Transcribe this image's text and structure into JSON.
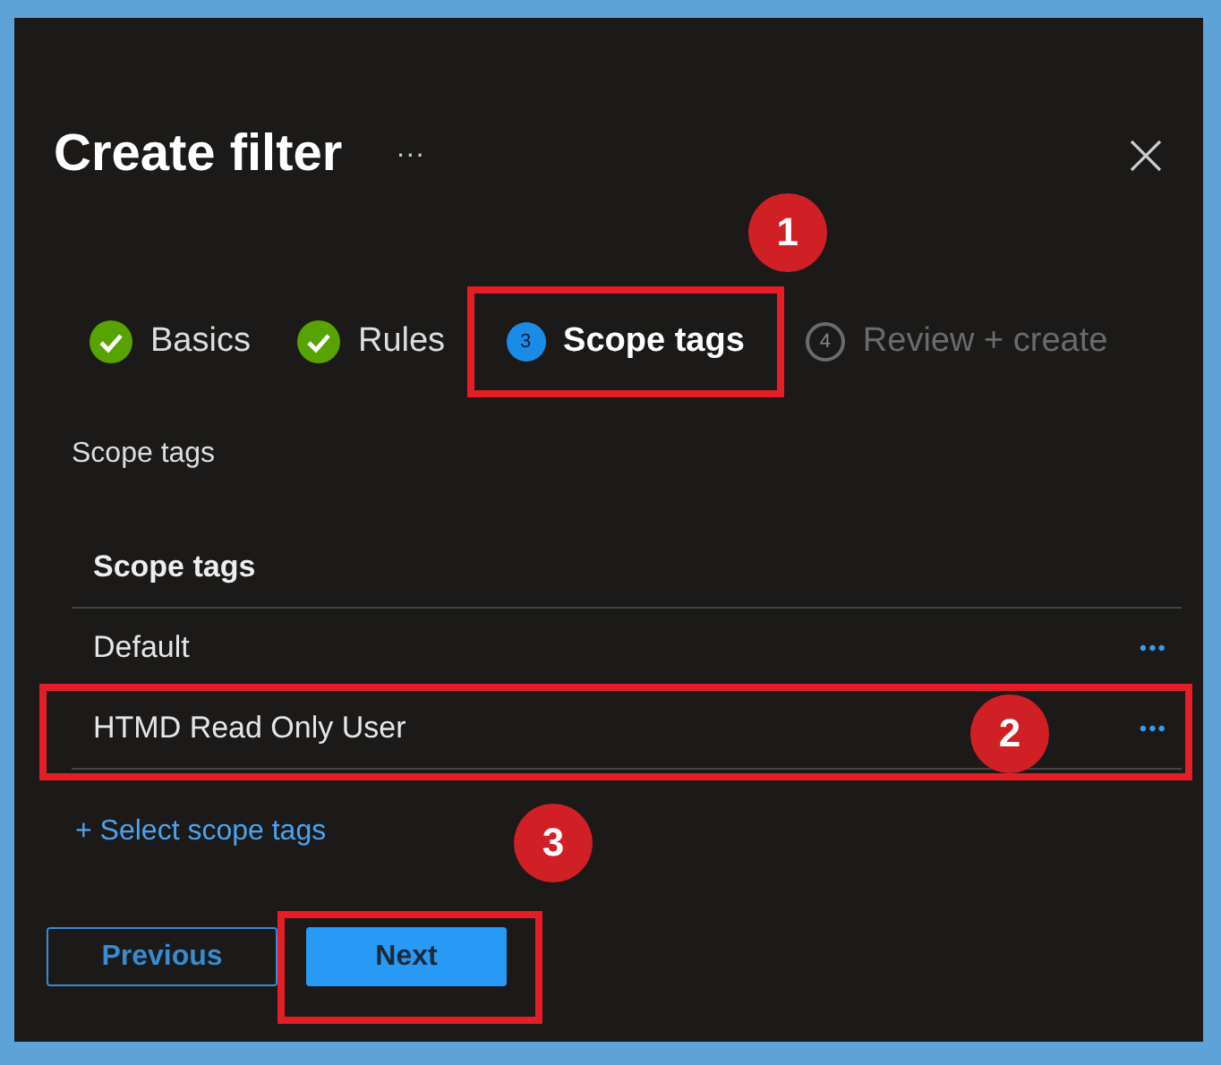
{
  "title": "Create filter",
  "more": "···",
  "steps": [
    {
      "label": "Basics",
      "completed": true,
      "selected": false
    },
    {
      "label": "Rules",
      "completed": true,
      "selected": false
    },
    {
      "label": "Scope tags",
      "number": "3",
      "completed": false,
      "selected": true,
      "callout": "1"
    },
    {
      "label": "Review + create",
      "number": "4",
      "completed": false,
      "selected": false
    }
  ],
  "section_label": "Scope tags",
  "table": {
    "header": "Scope tags",
    "rows": [
      {
        "name": "Default",
        "actions": "•••"
      },
      {
        "name": "HTMD Read Only User",
        "actions": "•••",
        "callout": "2"
      }
    ]
  },
  "add_link": "+ Select scope tags",
  "buttons": [
    {
      "label": "Previous",
      "kind": "secondary"
    },
    {
      "label": "Next",
      "kind": "primary",
      "callout": "3"
    }
  ]
}
